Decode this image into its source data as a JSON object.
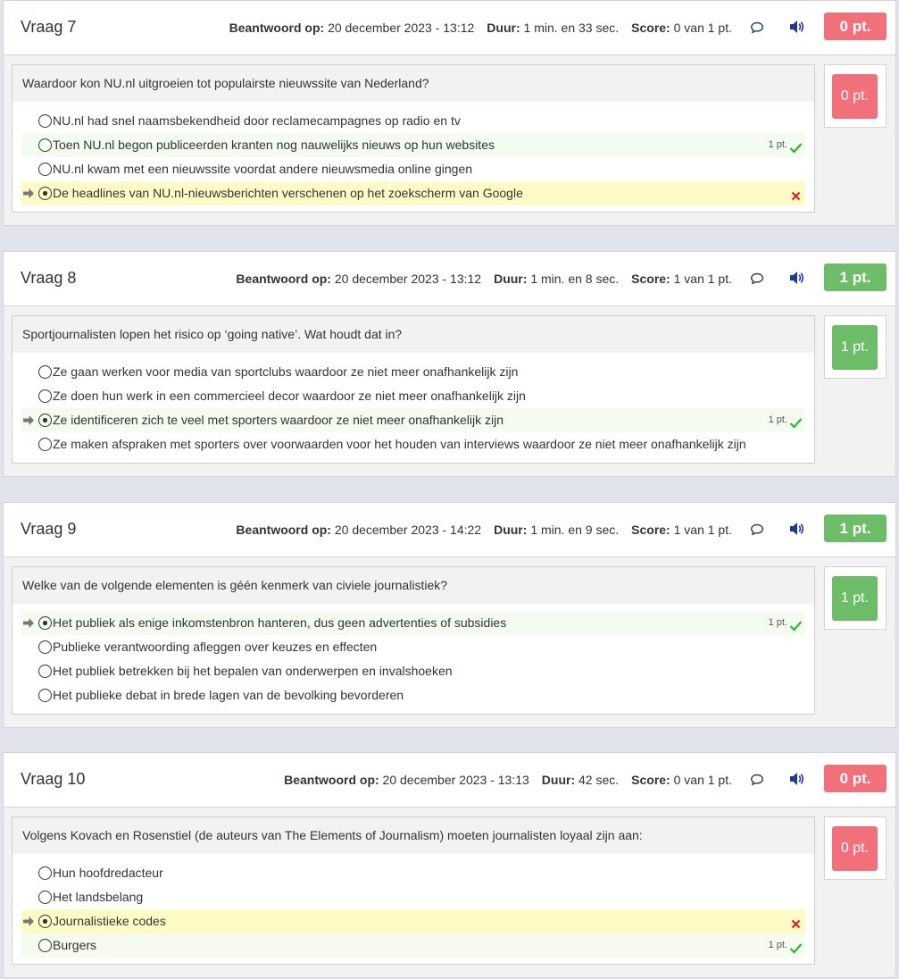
{
  "colors": {
    "score_zero": "#f2707a",
    "score_full": "#6dbd68",
    "correct_row": "#f5fbf0",
    "wrong_row": "#fffbc7"
  },
  "labels": {
    "answered": "Beantwoord op:",
    "duration": "Duur:",
    "score": "Score:"
  },
  "icons": {
    "comment": "comment-icon",
    "audio": "speaker-icon",
    "arrow": "arrow-right-icon",
    "check": "checkmark-icon",
    "cross": "cross-icon"
  },
  "questions": [
    {
      "title": "Vraag 7",
      "answered_on": "20 december 2023 - 13:12",
      "duration": "1 min. en 33 sec.",
      "score": "0 van 1 pt.",
      "badge": "0 pt.",
      "status": "wrong",
      "question": "Waardoor kon NU.nl uitgroeien tot populairste nieuwssite van Nederland?",
      "answers": [
        {
          "text": "NU.nl had snel naamsbekendheid door reclamecampagnes op radio en tv",
          "state": "none",
          "selected": false,
          "points": ""
        },
        {
          "text": "Toen NU.nl begon publiceerden kranten nog nauwelijks nieuws op hun websites",
          "state": "correct",
          "selected": false,
          "points": "1 pt."
        },
        {
          "text": "NU.nl kwam met een nieuwssite voordat andere nieuwsmedia online gingen",
          "state": "none",
          "selected": false,
          "points": ""
        },
        {
          "text": "De headlines van NU.nl-nieuwsberichten verschenen op het zoekscherm van Google",
          "state": "wrong",
          "selected": true,
          "points": ""
        }
      ]
    },
    {
      "title": "Vraag 8",
      "answered_on": "20 december 2023 - 13:12",
      "duration": "1 min. en 8 sec.",
      "score": "1 van 1 pt.",
      "badge": "1 pt.",
      "status": "correct",
      "question": "Sportjournalisten lopen het risico op ‘going native’. Wat houdt dat in?",
      "answers": [
        {
          "text": "Ze gaan werken voor media van sportclubs waardoor ze niet meer onafhankelijk zijn",
          "state": "none",
          "selected": false,
          "points": ""
        },
        {
          "text": "Ze doen hun werk in een commercieel decor waardoor ze niet meer onafhankelijk zijn",
          "state": "none",
          "selected": false,
          "points": ""
        },
        {
          "text": "Ze identificeren zich te veel met sporters waardoor ze niet meer onafhankelijk zijn",
          "state": "correct",
          "selected": true,
          "points": "1 pt."
        },
        {
          "text": "Ze maken afspraken met sporters over voorwaarden voor het houden van interviews waardoor ze niet meer onafhankelijk zijn",
          "state": "none",
          "selected": false,
          "points": ""
        }
      ]
    },
    {
      "title": "Vraag 9",
      "answered_on": "20 december 2023 - 14:22",
      "duration": "1 min. en 9 sec.",
      "score": "1 van 1 pt.",
      "badge": "1 pt.",
      "status": "correct",
      "question": "Welke van de volgende elementen is géén kenmerk van civiele journalistiek?",
      "answers": [
        {
          "text": "Het publiek als enige inkomstenbron hanteren, dus geen advertenties of subsidies",
          "state": "correct",
          "selected": true,
          "points": "1 pt."
        },
        {
          "text": "Publieke verantwoording afleggen over keuzes en effecten",
          "state": "none",
          "selected": false,
          "points": ""
        },
        {
          "text": "Het publiek betrekken bij het bepalen van onderwerpen en invalshoeken",
          "state": "none",
          "selected": false,
          "points": ""
        },
        {
          "text": "Het publieke debat in brede lagen van de bevolking bevorderen",
          "state": "none",
          "selected": false,
          "points": ""
        }
      ]
    },
    {
      "title": "Vraag 10",
      "answered_on": "20 december 2023 - 13:13",
      "duration": "42 sec.",
      "score": "0 van 1 pt.",
      "badge": "0 pt.",
      "status": "wrong",
      "question": "Volgens Kovach en Rosenstiel (de auteurs van The Elements of Journalism) moeten journalisten loyaal zijn aan:",
      "answers": [
        {
          "text": "Hun hoofdredacteur",
          "state": "none",
          "selected": false,
          "points": ""
        },
        {
          "text": "Het landsbelang",
          "state": "none",
          "selected": false,
          "points": ""
        },
        {
          "text": "Journalistieke codes",
          "state": "wrong",
          "selected": true,
          "points": ""
        },
        {
          "text": "Burgers",
          "state": "correct",
          "selected": false,
          "points": "1 pt."
        }
      ]
    }
  ]
}
